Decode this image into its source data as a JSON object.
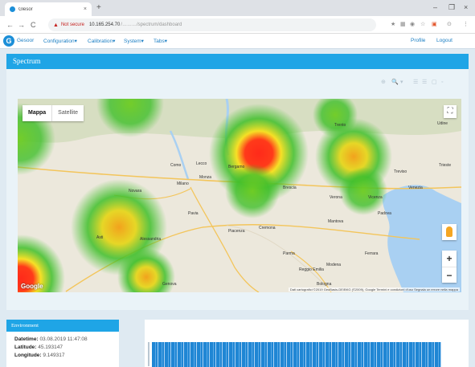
{
  "browser": {
    "tab_title": "Glesor",
    "tab_close": "×",
    "new_tab": "+",
    "window_controls": [
      "–",
      "❐",
      "×"
    ],
    "back": "←",
    "forward": "→",
    "reload": "C",
    "not_secure": "Not secure",
    "url": "10.165.254.70",
    "url_rest": "/………/spectrum/dashboard",
    "ext_icons": [
      "★",
      "▦",
      "◉",
      "☆",
      "▣",
      "⊙",
      "⋮"
    ]
  },
  "app": {
    "logo_letter": "G",
    "nav": [
      {
        "label": "Gesoor"
      },
      {
        "label": "Configuration▾"
      },
      {
        "label": "Calibration▾"
      },
      {
        "label": "System▾"
      },
      {
        "label": "Tabs▾"
      }
    ],
    "profile_label": "Profile",
    "logout_label": "Logout"
  },
  "section": {
    "title": "Spectrum",
    "tool_icons": [
      "⊕",
      "🔍",
      "▾",
      "☰",
      "☰",
      "▢",
      "◦"
    ]
  },
  "map": {
    "type_map": "Mappa",
    "type_satellite": "Satellite",
    "fullscreen": "⛶",
    "zoom_in": "+",
    "zoom_out": "−",
    "google": "Google",
    "attribution": "Dati cartografici ©2019 GeoBasis-DE/BKG (©2009), Google   Termini e condizioni d'uso   Segnala un errore nella mappa",
    "cities": [
      "Milano",
      "Monza",
      "Bergamo",
      "Brescia",
      "Verona",
      "Vicenza",
      "Padova",
      "Venezia",
      "Pavia",
      "Piacenza",
      "Parma",
      "Reggio Emilia",
      "Modena",
      "Bologna",
      "Ferrara",
      "Mantova",
      "Cremona",
      "Trento",
      "Treviso",
      "Novara",
      "Lecco",
      "Como",
      "Udine",
      "Trieste",
      "Genova",
      "Alessandria",
      "Asti"
    ],
    "colors": {
      "heat_hot": "#ff2a1a",
      "heat_mid": "#f7e01d",
      "heat_cool": "#3fbf2a",
      "water": "#a9d0f2"
    }
  },
  "info": {
    "title": "Environment",
    "rows": [
      {
        "label": "Datetime:",
        "value": "03.08.2019 11:47:08"
      },
      {
        "label": "Latitude:",
        "value": "45.193147"
      },
      {
        "label": "Longitude:",
        "value": "9.149317"
      }
    ]
  },
  "colors": {
    "accent": "#1fa5e6",
    "link": "#1c7fc4",
    "background": "#dfeaf2"
  }
}
